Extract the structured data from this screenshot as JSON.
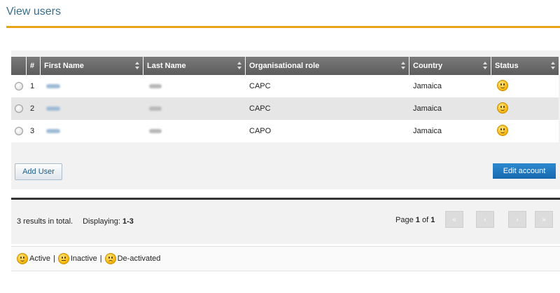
{
  "page": {
    "title": "View users"
  },
  "grid": {
    "columns": [
      {
        "label": ""
      },
      {
        "label": "#"
      },
      {
        "label": "First Name"
      },
      {
        "label": "Last Name"
      },
      {
        "label": "Organisational role"
      },
      {
        "label": "Country"
      },
      {
        "label": "Status"
      }
    ],
    "rows": [
      {
        "num": "1",
        "role": "CAPC",
        "country": "Jamaica",
        "status": "Active"
      },
      {
        "num": "2",
        "role": "CAPC",
        "country": "Jamaica",
        "status": "Active"
      },
      {
        "num": "3",
        "role": "CAPO",
        "country": "Jamaica",
        "status": "Active"
      }
    ]
  },
  "actions": {
    "add_user": "Add User",
    "edit_account": "Edit account"
  },
  "pager": {
    "results_text": "3 results in total.",
    "displaying_label": "Displaying:",
    "displaying_range": "1-3",
    "page_label": "Page",
    "current_page": "1",
    "of_label": "of",
    "total_pages": "1",
    "buttons": [
      "«",
      "‹",
      "›",
      "»"
    ]
  },
  "legend": {
    "active": "Active",
    "inactive": "Inactive",
    "deactivated": "De-activated",
    "separator": "|"
  },
  "colors": {
    "accent_rule": "#e8a317",
    "title": "#3a6d8c",
    "primary_button": "#1f78c1"
  }
}
